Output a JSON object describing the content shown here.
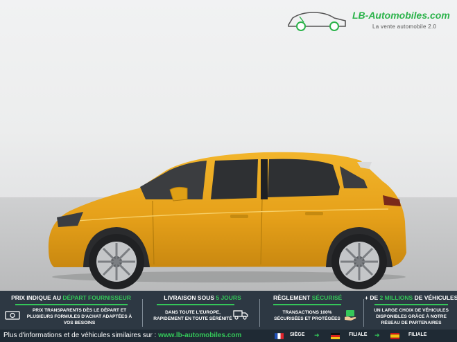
{
  "logo": {
    "brand": "LB-Automobiles.com",
    "tagline": "La vente automobile 2.0"
  },
  "features": [
    {
      "title_pre": "PRIX INDIQUE AU ",
      "title_hl": "DÉPART FOURNISSEUR",
      "title_post": "",
      "body": "PRIX TRANSPARENTS DÈS LE DÉPART ET PLUSIEURS FORMULES D'ACHAT ADAPTÉES À VOS BESOINS"
    },
    {
      "title_pre": "LIVRAISON SOUS ",
      "title_hl": "5 JOURS",
      "title_post": "",
      "body": "DANS TOUTE L'EUROPE, RAPIDEMENT EN TOUTE SÉRÉNITÉ"
    },
    {
      "title_pre": "RÈGLEMENT ",
      "title_hl": "SÉCURISÉ",
      "title_post": "",
      "body": "TRANSACTIONS 100% SÉCURISÉES ET PROTÉGÉES"
    },
    {
      "title_pre": "+ DE ",
      "title_hl": "2 MILLIONS",
      "title_post": " DE VÉHICULES",
      "body": "UN LARGE CHOIX DE VÉHICULES DISPONIBLES GRÂCE À NOTRE RÉSEAU DE PARTENAIRES"
    }
  ],
  "footer": {
    "text": "Plus d'informations et de véhicules similaires sur : ",
    "url": "www.lb-automobiles.com",
    "siege": "SIÈGE",
    "filiale1": "FILIALE",
    "filiale2": "FILIALE"
  },
  "colors": {
    "accent": "#34c759",
    "car": "#e9a81b",
    "band": "#2d3843"
  }
}
